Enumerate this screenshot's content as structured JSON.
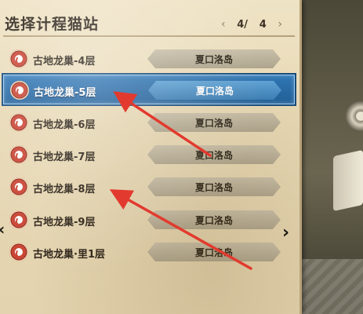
{
  "header": {
    "title": "选择计程猫站",
    "page_current": "4/",
    "page_total": "4",
    "prev_arrow": "‹",
    "next_arrow": "›"
  },
  "stations": [
    {
      "name": "古地龙巢-4层",
      "destination": "夏口洛岛",
      "selected": false
    },
    {
      "name": "古地龙巢-5层",
      "destination": "夏口洛岛",
      "selected": true
    },
    {
      "name": "古地龙巢-6层",
      "destination": "夏口洛岛",
      "selected": false
    },
    {
      "name": "古地龙巢-7层",
      "destination": "夏口洛岛",
      "selected": false
    },
    {
      "name": "古地龙巢-8层",
      "destination": "夏口洛岛",
      "selected": false
    },
    {
      "name": "古地龙巢-9层",
      "destination": "夏口洛岛",
      "selected": false
    },
    {
      "name": "古地龙巢·里1层",
      "destination": "夏口洛岛",
      "selected": false
    }
  ],
  "nav": {
    "left": "‹",
    "right": "›"
  },
  "colors": {
    "selected": "#2f77b6",
    "annotation": "#e23a2e",
    "parchment": "#e7d8b4"
  }
}
